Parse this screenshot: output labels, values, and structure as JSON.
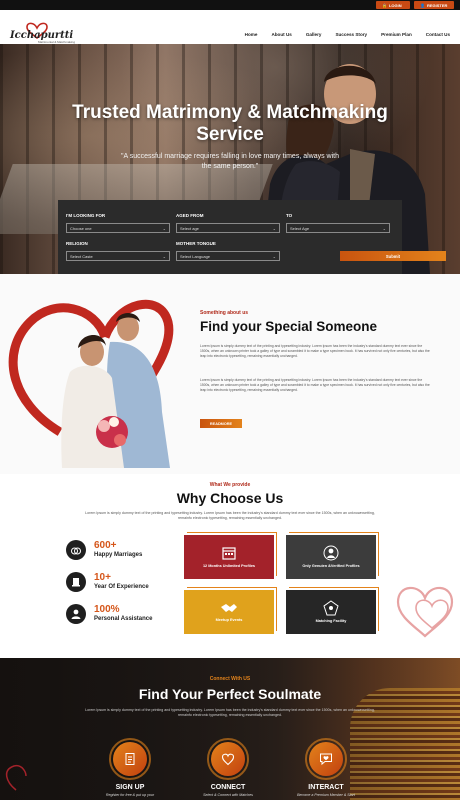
{
  "topbar": {
    "login": "LOGIN",
    "register": "REGISTER"
  },
  "brand": {
    "name": "Icchapurtti",
    "tagline": "Matrimonial & Matchmaking"
  },
  "nav": [
    "Home",
    "About Us",
    "Gallery",
    "Success Story",
    "Premium Plan",
    "Contact Us"
  ],
  "hero": {
    "title": "Trusted Matrimony & Matchmaking Service",
    "quote": "\"A successful marriage requires falling in love many times, always with the same person.\""
  },
  "search": {
    "looking_for": {
      "label": "I'M LOOKING FOR",
      "value": "Choose one"
    },
    "aged_from": {
      "label": "AGED FROM",
      "value": "Select age"
    },
    "to": {
      "label": "TO",
      "value": "Select Age"
    },
    "religion": {
      "label": "RELIGION",
      "value": "Select Caste"
    },
    "mother_tongue": {
      "label": "MOTHER TONGUE",
      "value": "Select Language"
    },
    "submit": "Submit"
  },
  "about": {
    "kicker": "Something about us",
    "title": "Find your Special Someone",
    "p1": "Lorem Ipsum is simply dummy text of the printing and typesetting industry. Lorem Ipsum has been the industry's standard dummy text ever since the 1500s, when an unknown printer took a galley of type and scrambled it to make a type specimen book. It has survived not only five centuries, but also the leap into electronic typesetting, remaining essentially unchanged.",
    "p2": "Lorem Ipsum is simply dummy text of the printing and typesetting industry. Lorem Ipsum has been the industry's standard dummy text ever since the 1500s, when an unknown printer took a galley of type and scrambled it to make a type specimen book. It has survived not only five centuries, but also the leap into electronic typesetting, remaining essentially unchanged.",
    "readmore": "READMORE"
  },
  "why": {
    "kicker": "What We provide",
    "title": "Why Choose Us",
    "desc": "Lorem Ipsum is simply dummy text of the printing and typesetting industry. Lorem Ipsum has been the industry's standard dummy text ever since the 1500s, when an unknownwetting, remainfo electronic typesetting, remaining essentially unchanged.",
    "stats": [
      {
        "num": "600+",
        "label": "Happy Marriages",
        "icon": "rings-icon"
      },
      {
        "num": "10+",
        "label": "Year Of Experience",
        "icon": "award-icon"
      },
      {
        "num": "100%",
        "label": "Personal Assistance",
        "icon": "user-icon"
      }
    ],
    "features": [
      {
        "text": "12 Months Unlimited Profiles",
        "icon": "calendar-icon",
        "color": "#a3222a"
      },
      {
        "text": "Only Genuien &Verified Profiles",
        "icon": "verified-user-icon",
        "color": "#3c3c3c"
      },
      {
        "text": "Meetup Events",
        "icon": "handshake-icon",
        "color": "#e0a21c"
      },
      {
        "text": "Matching Facility",
        "icon": "network-icon",
        "color": "#262626"
      }
    ]
  },
  "soulmate": {
    "kicker": "Connect With US",
    "title": "Find Your Perfect Soulmate",
    "desc": "Lorem Ipsum is simply dummy text of the printing and typesetting industry. Lorem Ipsum has been the industry's standard dummy text ever since the 1500s, when an unknownwetting, remainfo electronic typesetting, remaining essentially unchanged.",
    "steps": [
      {
        "title": "SIGN UP",
        "desc": "Register for free & put up your",
        "icon": "signup-form-icon"
      },
      {
        "title": "CONNECT",
        "desc": "Select & Connect with Matches",
        "icon": "heart-icon"
      },
      {
        "title": "INTERACT",
        "desc": "Become a Premium Member & Start",
        "icon": "chat-heart-icon"
      }
    ]
  },
  "colors": {
    "accent": "#d5561a",
    "accent_light": "#e3831b",
    "dark": "#2b2b2b",
    "red": "#a3222a"
  }
}
